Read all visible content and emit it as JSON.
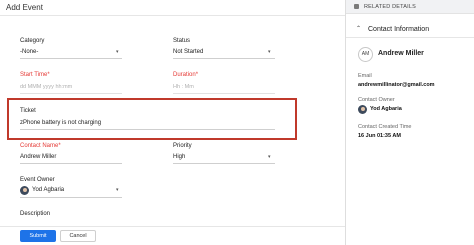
{
  "form": {
    "title": "Add Event",
    "category": {
      "label": "Category",
      "value": "-None-"
    },
    "status": {
      "label": "Status",
      "value": "Not Started"
    },
    "start_time": {
      "label": "Start Time",
      "placeholder": "dd MMM yyyy hh:mm"
    },
    "duration": {
      "label": "Duration",
      "placeholder": "Hh : Mm"
    },
    "ticket": {
      "label": "Ticket",
      "value": "zPhone battery is not charging"
    },
    "contact_name": {
      "label": "Contact Name",
      "value": "Andrew Miller"
    },
    "priority": {
      "label": "Priority",
      "value": "High"
    },
    "event_owner": {
      "label": "Event Owner",
      "value": "Yod Agbaria"
    },
    "description": {
      "label": "Description"
    },
    "required_mark": "*",
    "submit_label": "Submit",
    "cancel_label": "Cancel"
  },
  "sidebar": {
    "header": "RELATED DETAILS",
    "section_title": "Contact Information",
    "avatar_initials": "AM",
    "name": "Andrew Miller",
    "email_label": "Email",
    "email_value": "andrewmillinator@gmail.com",
    "owner_label": "Contact Owner",
    "owner_value": "Yod Agbaria",
    "created_label": "Contact Created Time",
    "created_value": "16 Jun 01:35 AM"
  },
  "colors": {
    "accent": "#1e73e8",
    "required": "#e53935",
    "highlight_border": "#c0392b"
  },
  "icons": [
    "chevron-down-icon",
    "chevron-up-icon",
    "related-details-icon",
    "avatar-icon"
  ]
}
